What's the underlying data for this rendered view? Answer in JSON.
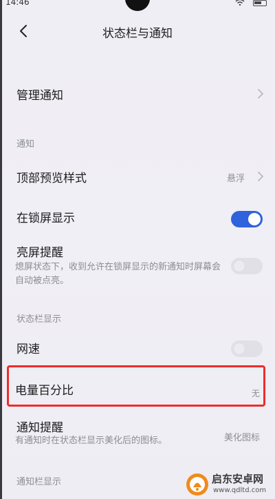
{
  "status_bar": {
    "time": "14:46"
  },
  "header": {
    "title": "状态栏与通知"
  },
  "items": {
    "manage_notifications": {
      "title": "管理通知"
    },
    "section_notifications": "通知",
    "top_preview_style": {
      "title": "顶部预览样式",
      "value": "悬浮"
    },
    "lock_screen_display": {
      "title": "在锁屏显示",
      "enabled": true
    },
    "screen_wake": {
      "title": "亮屏提醒",
      "desc": "熄屏状态下，收到允许在锁屏显示的新通知时屏幕会自动被点亮。",
      "enabled": false
    },
    "section_status_bar": "状态栏显示",
    "network_speed": {
      "title": "网速",
      "enabled": false
    },
    "battery_percentage": {
      "title": "电量百分比",
      "value": "无"
    },
    "notification_indicator": {
      "title": "通知提醒",
      "desc": "有通知时在状态栏显示美化后的图标。",
      "value": "美化图标"
    },
    "section_notification_bar": "通知栏显示"
  },
  "watermark": {
    "title": "启东安卓网",
    "url": "www.qdltd.com"
  },
  "colors": {
    "accent": "#2f62dd",
    "highlight": "#ef2b2b"
  }
}
